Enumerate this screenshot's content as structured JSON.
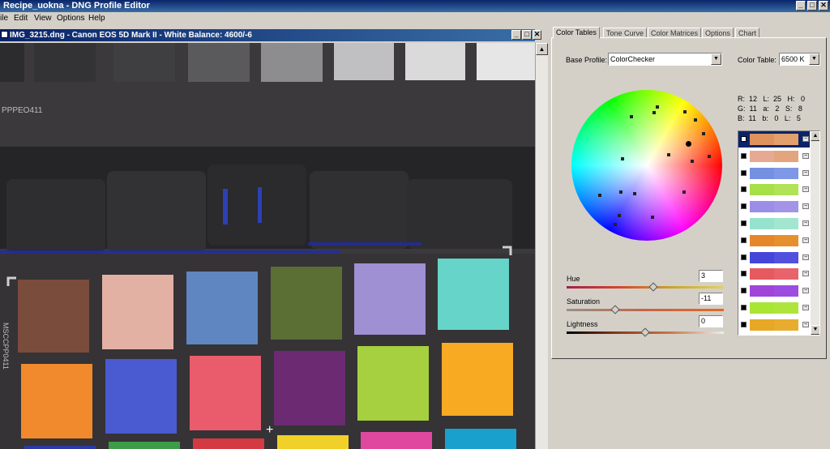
{
  "app": {
    "title": "Recipe_uokna - DNG Profile Editor",
    "window_controls": [
      "_",
      "□",
      "✕"
    ]
  },
  "menu": [
    "ile",
    "Edit",
    "View",
    "Options",
    "Help"
  ],
  "image_window": {
    "title": "IMG_3215.dng  - Canon EOS 5D Mark II - White Balance: 4600/-6",
    "controls": [
      "_",
      "□",
      "✕"
    ],
    "card_text_top": "PPPEO411",
    "card_text_side": "MSCCPP0411"
  },
  "tabs": [
    "Color Tables",
    "Tone Curve",
    "Color Matrices",
    "Options",
    "Chart"
  ],
  "active_tab": "Color Tables",
  "base_profile": {
    "label": "Base Profile:",
    "value": "ColorChecker"
  },
  "color_table": {
    "label": "Color Table:",
    "value": "6500 K"
  },
  "readout": {
    "row1": "R:  12   L:  25   H:   0",
    "row2": "G:  11   a:   2   S:   8",
    "row3": "B:  11   b:   0   L:   5"
  },
  "sliders": [
    {
      "label": "Hue",
      "value": "3"
    },
    {
      "label": "Saturation",
      "value": "-11"
    },
    {
      "label": "Lightness",
      "value": "0"
    }
  ],
  "slider_positions": [
    0.55,
    0.31,
    0.5
  ],
  "swatches": [
    {
      "from": "#e0925e",
      "to": "#e39f6c"
    },
    {
      "from": "#e6aa93",
      "to": "#e3a57e"
    },
    {
      "from": "#7490e0",
      "to": "#7f98e6"
    },
    {
      "from": "#a7df49",
      "to": "#b0e357"
    },
    {
      "from": "#9b8ee6",
      "to": "#a394e8"
    },
    {
      "from": "#95e3cf",
      "to": "#a3e6cf"
    },
    {
      "from": "#e6862b",
      "to": "#e6902d"
    },
    {
      "from": "#4545d9",
      "to": "#5151de"
    },
    {
      "from": "#e6595f",
      "to": "#e8636b"
    },
    {
      "from": "#a144d8",
      "to": "#9c4de0"
    },
    {
      "from": "#a8e634",
      "to": "#aee53c"
    },
    {
      "from": "#e6a825",
      "to": "#e8ac2e"
    }
  ],
  "icons": {
    "minimize": "minimize-icon",
    "maximize": "maximize-icon",
    "close": "close-icon",
    "dropdown": "dropdown-arrow-icon",
    "scroll_up": "scroll-up-icon",
    "scroll_down": "scroll-down-icon",
    "remove": "minus-icon"
  }
}
